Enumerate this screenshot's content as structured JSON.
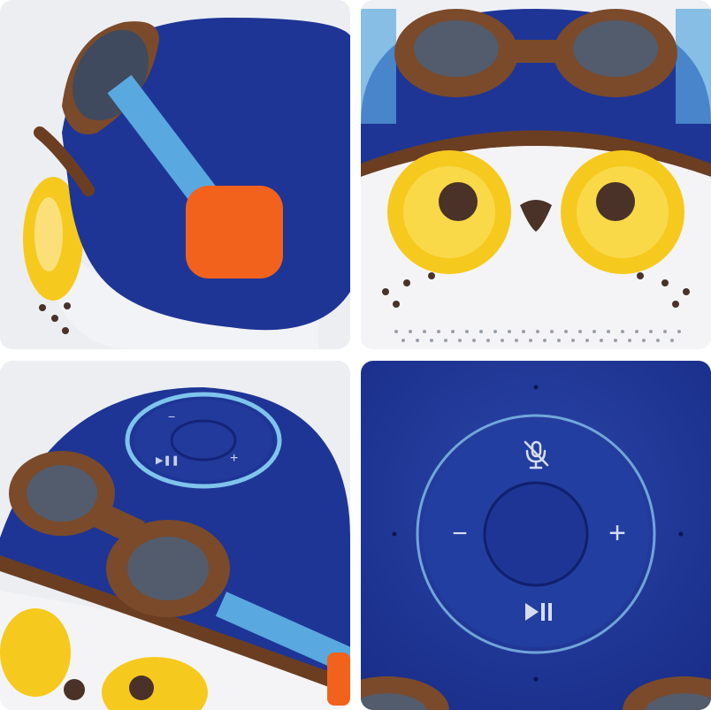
{
  "colors": {
    "background": "#ffffff",
    "helmet_blue": "#1e3596",
    "helmet_dark": "#142478",
    "strap_light_blue": "#5aa8e0",
    "goggle_brown": "#7a4a2a",
    "lens_gray": "#5b6270",
    "eye_yellow": "#f6c91e",
    "pupil": "#4a3228",
    "face_white": "#f4f4f6",
    "orange_patch": "#f2621c",
    "ring_glow": "#7fc4ec"
  },
  "panels": [
    {
      "name": "side-view",
      "description_icon": "owl-speaker-side"
    },
    {
      "name": "front-view",
      "description_icon": "owl-speaker-front"
    },
    {
      "name": "top-angle-view",
      "description_icon": "owl-speaker-top-angle"
    },
    {
      "name": "control-panel-closeup",
      "description_icon": "owl-speaker-controls"
    }
  ],
  "controls": {
    "mute_icon": "mic-mute-icon",
    "volume_down_symbol": "−",
    "volume_up_symbol": "+",
    "play_pause_icon": "play-pause-icon"
  }
}
